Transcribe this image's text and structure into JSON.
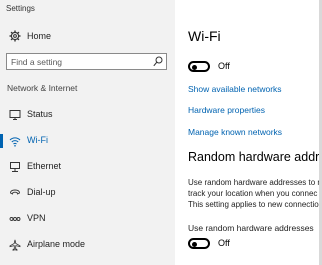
{
  "window": {
    "title": "Settings"
  },
  "sidebar": {
    "home_label": "Home",
    "search_placeholder": "Find a setting",
    "section_label": "Network & Internet",
    "items": [
      {
        "label": "Status",
        "icon": "status-icon"
      },
      {
        "label": "Wi-Fi",
        "icon": "wifi-icon",
        "active": true
      },
      {
        "label": "Ethernet",
        "icon": "ethernet-icon"
      },
      {
        "label": "Dial-up",
        "icon": "dialup-icon"
      },
      {
        "label": "VPN",
        "icon": "vpn-icon"
      },
      {
        "label": "Airplane mode",
        "icon": "airplane-icon"
      }
    ]
  },
  "main": {
    "title": "Wi-Fi",
    "wifi_toggle": {
      "state": "Off",
      "on": false
    },
    "links": {
      "show_networks": "Show available networks",
      "hardware_properties": "Hardware properties",
      "manage_networks": "Manage known networks"
    },
    "random_hw": {
      "title": "Random hardware addre",
      "description_lines": [
        "Use random hardware addresses to m",
        "track your location when you connec",
        "This setting applies to new connectio"
      ],
      "toggle_label": "Use random hardware addresses",
      "toggle": {
        "state": "Off",
        "on": false
      }
    }
  },
  "colors": {
    "accent": "#0063b1",
    "sidebar_bg": "#f2f2f2",
    "text": "#1f1f1f"
  }
}
